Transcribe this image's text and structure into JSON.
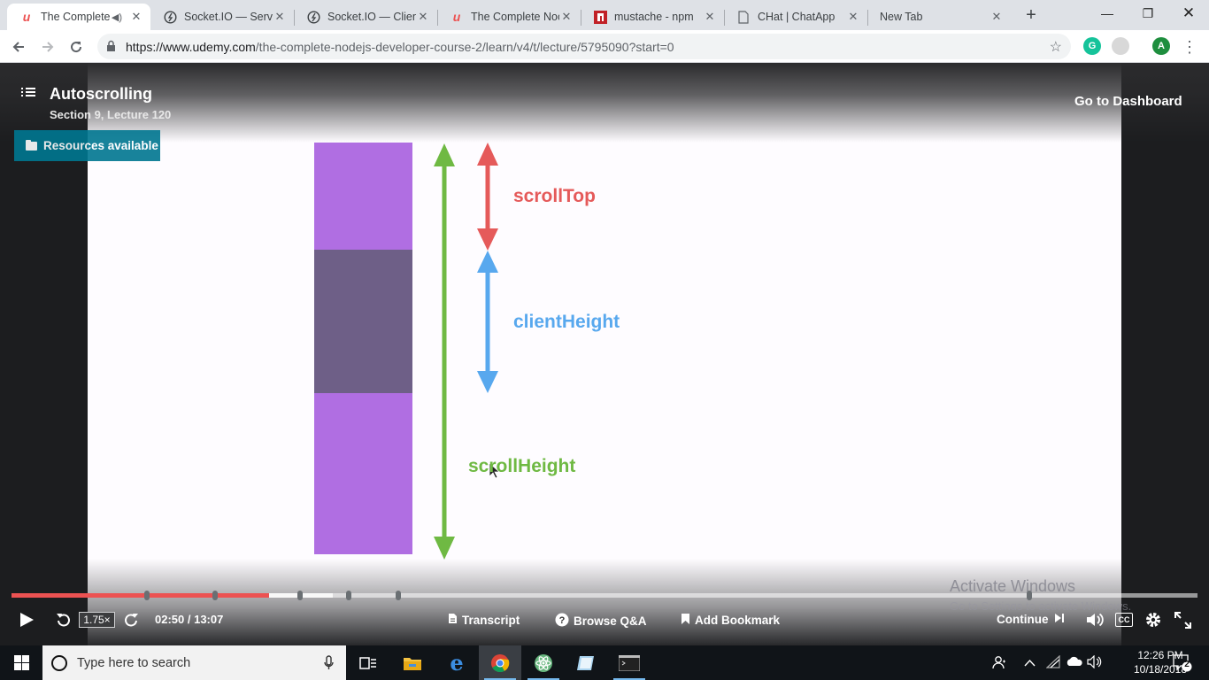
{
  "browser": {
    "tabs": [
      {
        "title": "The Complete",
        "icon": "udemy-icon",
        "active": true,
        "audio": true
      },
      {
        "title": "Socket.IO — Serve",
        "icon": "socketio-icon"
      },
      {
        "title": "Socket.IO — Client",
        "icon": "socketio-icon"
      },
      {
        "title": "The Complete Noc",
        "icon": "udemy-icon"
      },
      {
        "title": "mustache - npm",
        "icon": "npm-icon"
      },
      {
        "title": "CHat | ChatApp",
        "icon": "page-icon"
      },
      {
        "title": "New Tab",
        "icon": ""
      }
    ],
    "url_host": "https://www.udemy.com",
    "url_path": "/the-complete-nodejs-developer-course-2/learn/v4/t/lecture/5795090?start=0",
    "profile_initial": "A",
    "grammarly_initial": "G"
  },
  "player": {
    "lecture_title": "Autoscrolling",
    "lecture_subtitle": "Section 9, Lecture 120",
    "go_dashboard": "Go to Dashboard",
    "resources_label": "Resources available",
    "diagram": {
      "scroll_top_label": "scrollTop",
      "client_height_label": "clientHeight",
      "scroll_height_label": "scrollHeight",
      "colors": {
        "purple": "#b06ee2",
        "dark": "#6e5f87",
        "green": "#6fb943",
        "red": "#e55a5a",
        "blue": "#58a8ee"
      }
    },
    "progress": {
      "played_fraction": 0.217,
      "buffered_fraction": 0.271,
      "marker_fractions": [
        0.114,
        0.172,
        0.243,
        0.284,
        0.326,
        0.858
      ]
    },
    "speed": "1.75×",
    "time": "02:50 / 13:07",
    "transcript": "Transcript",
    "browse_qa": "Browse Q&A",
    "add_bookmark": "Add Bookmark",
    "continue": "Continue",
    "watermark_line1": "Activate Windows",
    "watermark_line2": "Go to Settings to activate Windows.",
    "accent_color": "#ec5252"
  },
  "taskbar": {
    "search_placeholder": "Type here to search",
    "time": "12:26 PM",
    "date": "10/18/2018",
    "notifications": "2"
  }
}
